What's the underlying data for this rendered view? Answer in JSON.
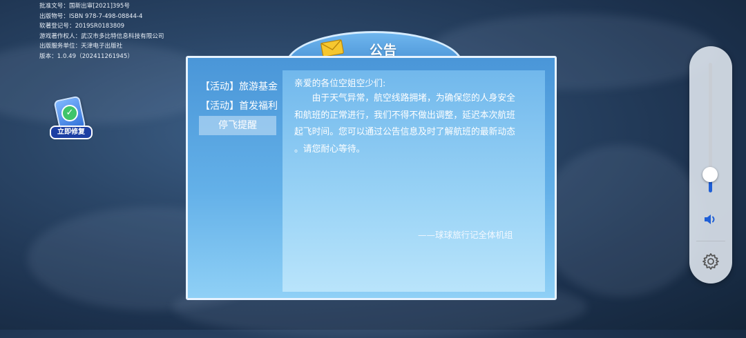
{
  "license_lines": [
    "批准文号：国新出审[2021]395号",
    "出版物号：ISBN 978-7-498-08844-4",
    "软著登记号：2019SR0183809",
    "游戏著作权人：武汉市多比特信息科技有限公司",
    "出版服务单位：天津电子出版社",
    "版本：1.0.49（202411261945）"
  ],
  "repair_label": "立即修复",
  "dialog": {
    "title": "公告",
    "menu": [
      {
        "label": "【活动】旅游基金",
        "active": false
      },
      {
        "label": "【活动】首发福利",
        "active": false
      },
      {
        "label": "停飞提醒",
        "active": true
      }
    ],
    "greeting": "亲爱的各位空姐空少们:",
    "body_lines": [
      "　　由于天气异常，航空线路拥堵，为确保您的人身安全",
      "和航班的正常进行，我们不得不做出调整，延迟本次航班",
      "起飞时间。您可以通过公告信息及时了解航班的最新动态",
      "。请您耐心等待。"
    ],
    "signature": "——球球旅行记全体机组"
  },
  "side_panel": {
    "volume_level": 0.14,
    "icons": [
      "speaker-icon",
      "gear-icon"
    ]
  },
  "colors": {
    "accent": "#1f5fd6",
    "panel_blue": "#4a96d8"
  }
}
